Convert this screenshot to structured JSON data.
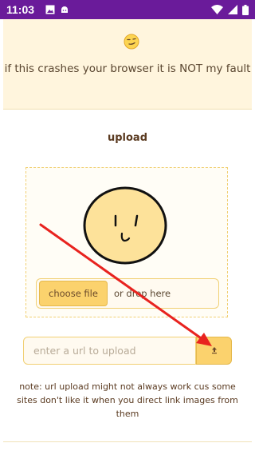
{
  "status_bar": {
    "time": "11:03",
    "left_icons": [
      "image-icon",
      "android-icon"
    ],
    "right_icons": [
      "wifi-icon",
      "signal-icon",
      "battery-icon"
    ],
    "background": "#6a1b9a"
  },
  "header": {
    "emoji_icon": "smirk-emoji-icon",
    "disclaimer": "if this crashes your browser it is NOT my fault"
  },
  "upload": {
    "title": "upload",
    "choose_file_label": "choose file",
    "drop_text": "or drop here",
    "url_placeholder": "enter a url to upload",
    "url_submit_icon": "upload-arrow-icon",
    "note": "note: url upload might not always work cus some sites don't like it when you direct link images from them"
  },
  "annotation": {
    "arrow_color": "#e8231f"
  },
  "colors": {
    "accent": "#fbd26d",
    "panel_bg": "#fff5dd",
    "text": "#5a4630"
  }
}
